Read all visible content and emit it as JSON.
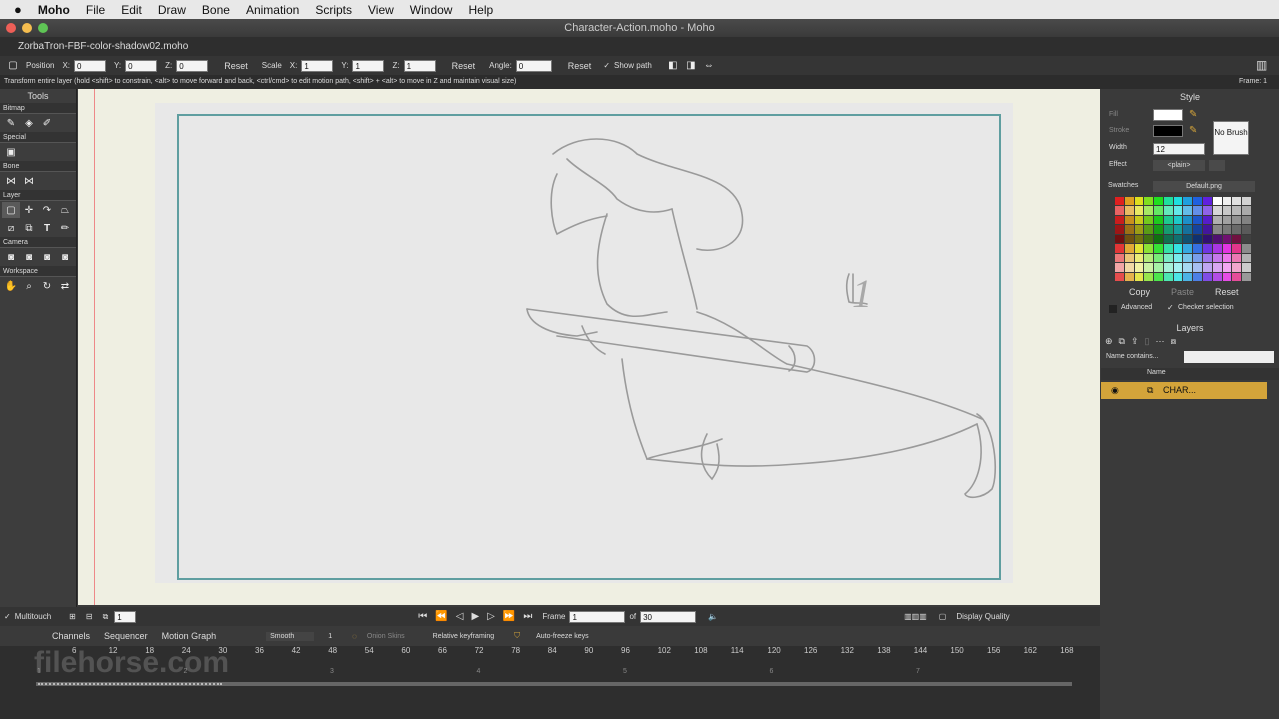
{
  "menubar": {
    "app": "Moho",
    "items": [
      "File",
      "Edit",
      "Draw",
      "Bone",
      "Animation",
      "Scripts",
      "View",
      "Window",
      "Help"
    ]
  },
  "window": {
    "title": "Character-Action.moho - Moho"
  },
  "document_tab": "ZorbaTron-FBF-color-shadow02.moho",
  "options": {
    "position_label": "Position",
    "x_label": "X:",
    "x_value": "0",
    "y_label": "Y:",
    "y_value": "0",
    "z_label": "Z:",
    "z_value": "0",
    "reset1": "Reset",
    "scale_label": "Scale",
    "sx_label": "X:",
    "sx_value": "1",
    "sy_label": "Y:",
    "sy_value": "1",
    "sz_label": "Z:",
    "sz_value": "1",
    "reset2": "Reset",
    "angle_label": "Angle:",
    "angle_value": "0",
    "reset3": "Reset",
    "show_path": "Show path"
  },
  "hint": "Transform entire layer (hold <shift> to constrain, <alt> to move forward and back, <ctrl/cmd> to edit motion path, <shift> + <alt> to move in Z and maintain visual size)",
  "frame_indicator": "Frame: 1",
  "tools": {
    "title": "Tools",
    "sections": [
      "Bitmap",
      "Special",
      "Bone",
      "Layer",
      "Camera",
      "Workspace"
    ]
  },
  "canvas": {
    "annotation": "1"
  },
  "style": {
    "title": "Style",
    "fill": "Fill",
    "stroke": "Stroke",
    "width_label": "Width",
    "width_value": "12",
    "effect_label": "Effect",
    "effect_value": "<plain>",
    "no_brush": "No Brush",
    "swatches_label": "Swatches",
    "swatches_value": "Default.png",
    "copy": "Copy",
    "paste": "Paste",
    "reset": "Reset",
    "advanced": "Advanced",
    "checker": "Checker selection"
  },
  "layers": {
    "title": "Layers",
    "filter": "Name contains...",
    "name_header": "Name",
    "row": "CHAR..."
  },
  "transport": {
    "multitouch": "Multitouch",
    "frame_label": "Frame",
    "frame_value": "1",
    "of": "of",
    "total": "30",
    "display_quality": "Display Quality",
    "small_field": "1"
  },
  "timeline": {
    "tabs": [
      "Channels",
      "Sequencer",
      "Motion Graph"
    ],
    "interp": "Smooth",
    "interp_num": "1",
    "onion": "Onion Skins",
    "relative": "Relative keyframing",
    "autofreeze": "Auto-freeze keys",
    "ticks": [
      "6",
      "12",
      "18",
      "24",
      "30",
      "36",
      "42",
      "48",
      "54",
      "60",
      "66",
      "72",
      "78",
      "84",
      "90",
      "96",
      "102",
      "108",
      "114",
      "120",
      "126",
      "132",
      "138",
      "144",
      "150",
      "156",
      "162",
      "168"
    ],
    "seconds": [
      "1",
      "2",
      "3",
      "4",
      "5",
      "6",
      "7"
    ]
  },
  "watermark": "filehorse.com",
  "colors": {
    "accent": "#d4a43a",
    "frame": "#5f9ea0"
  }
}
